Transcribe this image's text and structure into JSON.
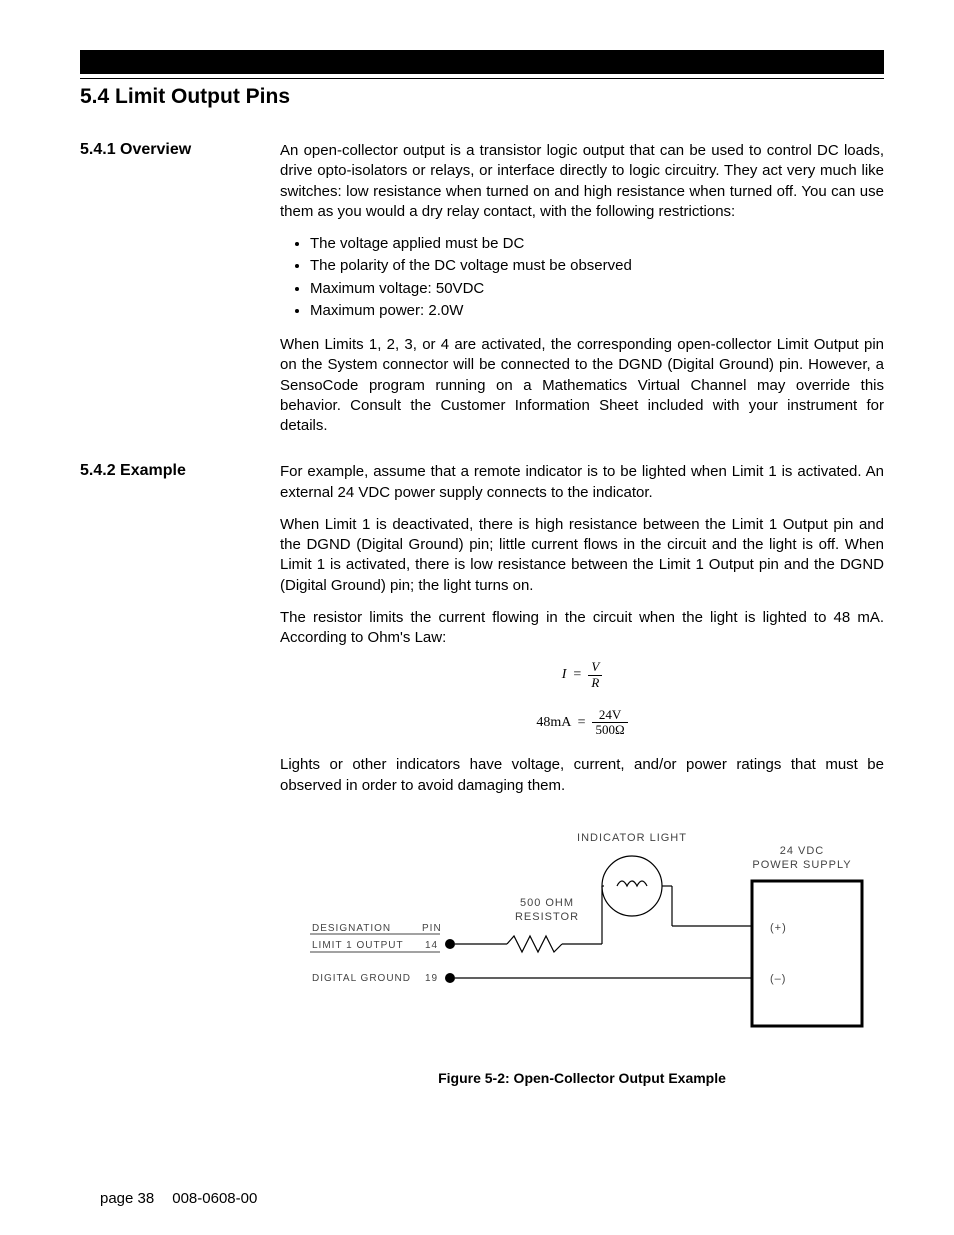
{
  "section": {
    "title": "5.4  Limit Output Pins"
  },
  "sub1": {
    "heading": "5.4.1 Overview",
    "p1": "An open-collector output is a transistor logic output that can be used to control DC loads, drive opto-isolators or relays, or interface directly to logic circuitry. They act very much like switches: low resistance when turned on and high resistance when turned off.  You can use them as you would a dry relay contact, with the following restrictions:",
    "bullets": [
      "The voltage applied must be DC",
      "The polarity of the DC voltage must be observed",
      "Maximum voltage: 50VDC",
      "Maximum power: 2.0W"
    ],
    "p2": "When Limits 1, 2, 3, or 4 are activated, the corresponding open-collector Limit Output pin on the System connector will be connected to the DGND (Digital Ground) pin. However, a SensoCode program running on a Mathematics Virtual Channel may override this behavior. Consult the Customer Information Sheet included with your instrument for details."
  },
  "sub2": {
    "heading": "5.4.2 Example",
    "p1": "For example, assume that a remote indicator is to be lighted when Limit 1 is activated. An external 24 VDC power supply connects to the indicator.",
    "p2": "When Limit 1 is deactivated, there is high resistance between the Limit 1 Output pin and the DGND (Digital Ground) pin; little current flows in the circuit and the light is off. When Limit 1 is activated, there is low resistance between the Limit 1 Output pin and the DGND (Digital Ground) pin; the light turns on.",
    "p3": "The resistor limits the current flowing in the circuit when the light is lighted to 48 mA. According to Ohm's Law:",
    "eq1": {
      "lhs": "I",
      "eq": "=",
      "num": "V",
      "den": "R"
    },
    "eq2": {
      "lhs": "48mA",
      "eq": "=",
      "num": "24V",
      "den": "500Ω"
    },
    "p4": "Lights or other indicators have voltage, current, and/or power ratings that must be observed in order to avoid damaging them."
  },
  "figure": {
    "labels": {
      "indicator": "INDICATOR  LIGHT",
      "supply_line1": "24  VDC",
      "supply_line2": "POWER  SUPPLY",
      "resistor_line1": "500  OHM",
      "resistor_line2": "RESISTOR",
      "designation": "DESIGNATION",
      "pin": "PIN",
      "limit1": "LIMIT  1  OUTPUT",
      "limit1_pin": "14",
      "dgnd": "DIGITAL  GROUND",
      "dgnd_pin": "19",
      "plus": "(+)",
      "minus": "(–)"
    },
    "caption": "Figure 5-2: Open-Collector Output Example"
  },
  "footer": {
    "page": "page 38",
    "doc": "008-0608-00"
  }
}
